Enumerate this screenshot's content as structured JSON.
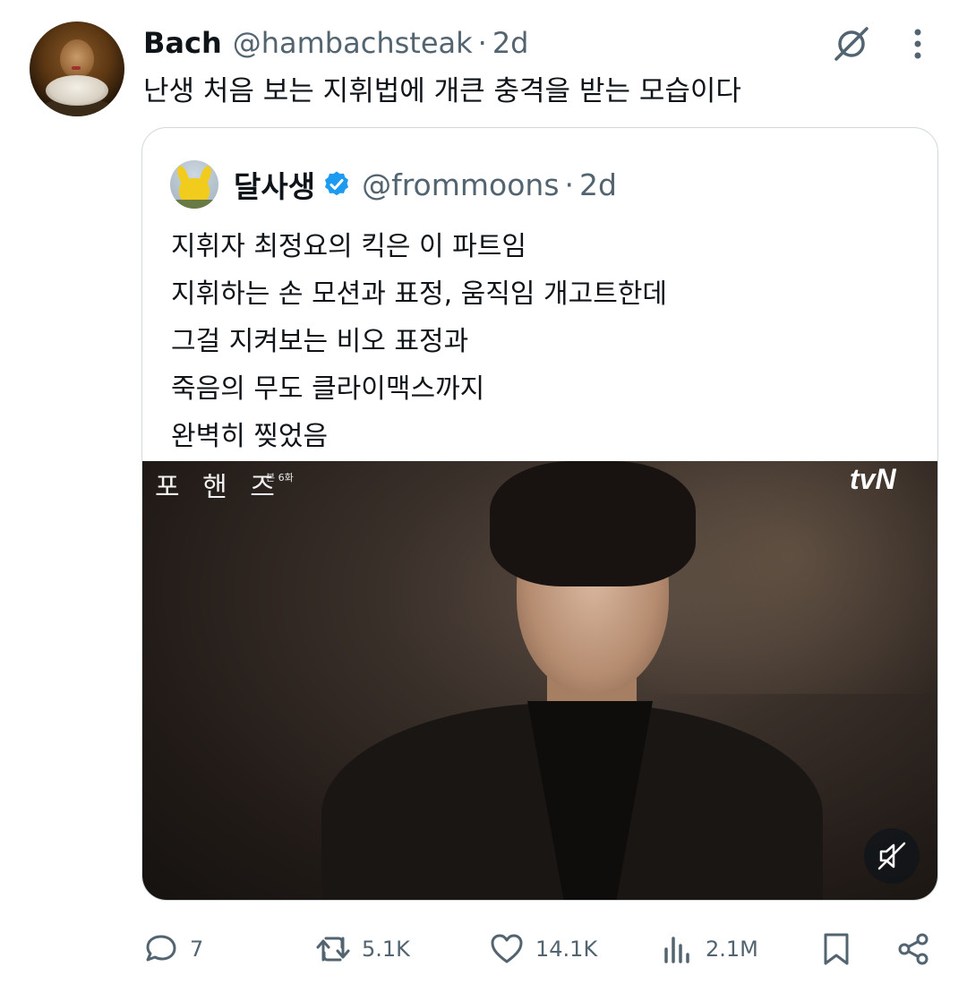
{
  "author": {
    "name": "Bach",
    "handle": "@hambachsteak",
    "separator": "·",
    "time": "2d"
  },
  "tweet": {
    "text": "난생 처음 보는 지휘법에 개큰 충격을 받는 모습이다"
  },
  "quote": {
    "name": "달사생",
    "handle": "@frommoons",
    "separator": "·",
    "time": "2d",
    "lines": [
      "지휘자 최정요의 킥은 이 파트임",
      "지휘하는 손 모션과 표정, 움직임 개고트한데",
      "그걸 지켜보는 비오 표정과",
      "죽음의 무도 클라이맥스까지",
      "완벽히 찢었음"
    ],
    "video": {
      "caption": "포 핸 즈",
      "caption_small": "본 6화",
      "logo": "tvN"
    }
  },
  "actions": {
    "replies": "7",
    "reposts": "5.1K",
    "likes": "14.1K",
    "views": "2.1M"
  },
  "colors": {
    "text": "#0f1419",
    "secondary": "#536471",
    "verified": "#1d9bf0",
    "border": "#cfd9de"
  },
  "icons": [
    "grok-icon",
    "more-icon",
    "verified-icon",
    "mute-icon",
    "reply-icon",
    "repost-icon",
    "like-icon",
    "views-icon",
    "bookmark-icon",
    "share-icon"
  ]
}
